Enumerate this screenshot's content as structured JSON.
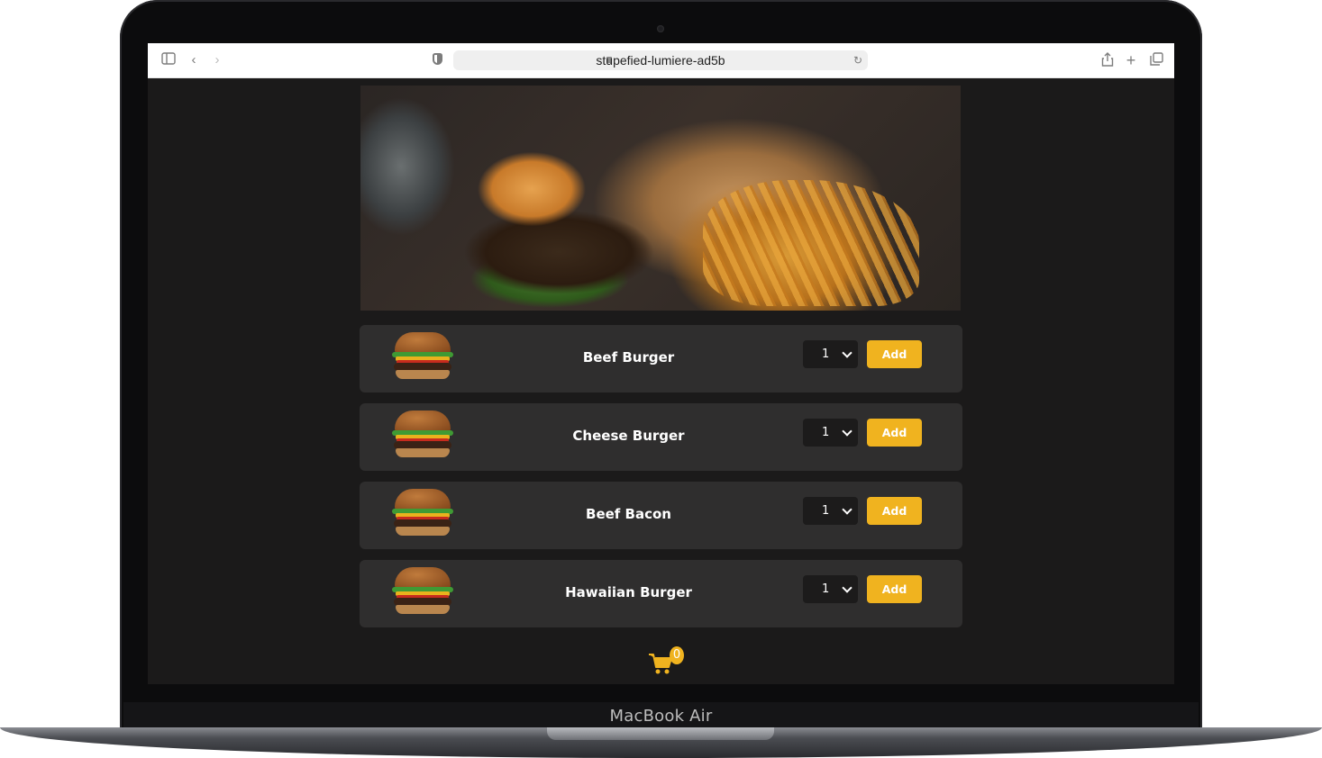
{
  "device": {
    "label": "MacBook Air"
  },
  "browser": {
    "url": "stupefied-lumiere-ad5b",
    "icons": [
      "sidebar-icon",
      "back-icon",
      "forward-icon",
      "shield-icon",
      "lock-icon",
      "reload-icon",
      "share-icon",
      "new-tab-icon",
      "tabs-icon"
    ]
  },
  "hero": {
    "alt_icon": "burger-and-fries-photo"
  },
  "menu": {
    "items": [
      {
        "name": "Beef Burger",
        "quantity": "1",
        "add_label": "Add"
      },
      {
        "name": "Cheese Burger",
        "quantity": "1",
        "add_label": "Add"
      },
      {
        "name": "Beef Bacon",
        "quantity": "1",
        "add_label": "Add"
      },
      {
        "name": "Hawaiian Burger",
        "quantity": "1",
        "add_label": "Add"
      }
    ]
  },
  "cart": {
    "count": "0",
    "icon": "cart-icon"
  },
  "colors": {
    "accent": "#f0b31f",
    "page_bg": "#1b1a1a",
    "card_bg": "#2f2e2e"
  }
}
